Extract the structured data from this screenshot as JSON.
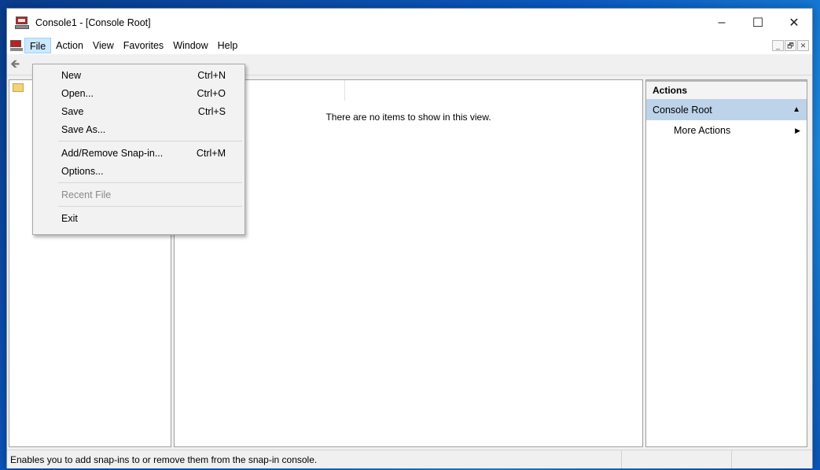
{
  "window": {
    "title": "Console1 - [Console Root]"
  },
  "title_controls": {
    "minimize": "–",
    "maximize": "☐",
    "close": "✕"
  },
  "menubar": {
    "items": [
      "File",
      "Action",
      "View",
      "Favorites",
      "Window",
      "Help"
    ],
    "active": "File",
    "mdi_controls": {
      "minimize": "_",
      "restore": "🗗",
      "close": "✕"
    }
  },
  "file_menu": {
    "items": [
      {
        "label": "New",
        "shortcut": "Ctrl+N"
      },
      {
        "label": "Open...",
        "shortcut": "Ctrl+O"
      },
      {
        "label": "Save",
        "shortcut": "Ctrl+S"
      },
      {
        "label": "Save As...",
        "shortcut": ""
      },
      {
        "label": "Add/Remove Snap-in...",
        "shortcut": "Ctrl+M"
      },
      {
        "label": "Options...",
        "shortcut": ""
      },
      {
        "label": "Recent File",
        "shortcut": "",
        "disabled": true
      },
      {
        "label": "Exit",
        "shortcut": ""
      }
    ]
  },
  "center": {
    "empty_message": "There are no items to show in this view."
  },
  "actions": {
    "header": "Actions",
    "section": "Console Root",
    "items": [
      "More Actions"
    ]
  },
  "statusbar": {
    "text": "Enables you to add snap-ins to or remove them from the snap-in console."
  },
  "colors": {
    "selection": "#cce8ff",
    "actions_section": "#bcd3ea",
    "menu_bg": "#f2f2f2"
  },
  "icons": {
    "app": "mmc-console-icon",
    "back": "back-arrow-icon",
    "tree": "folder-icon"
  }
}
